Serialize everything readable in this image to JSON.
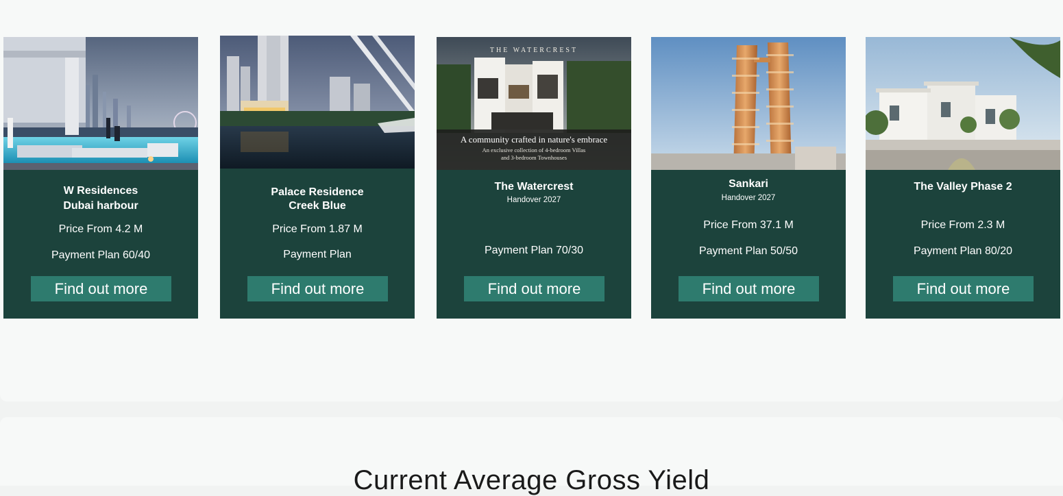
{
  "cards": [
    {
      "title_line1": "W Residences",
      "title_line2": "Dubai harbour",
      "price": "Price From 4.2 M",
      "payment": "Payment Plan 60/40",
      "button": "Find out more"
    },
    {
      "title_line1": "Palace Residence",
      "title_line2": "Creek Blue",
      "price": "Price From 1.87 M",
      "payment": "Payment Plan",
      "button": "Find out more"
    },
    {
      "title_line1": "The Watercrest",
      "subtitle": "Handover 2027",
      "price": "",
      "payment": "Payment Plan 70/30",
      "button": "Find out more",
      "image_text": {
        "brand": "THE WATERCREST",
        "tagline": "A community crafted in nature's embrace",
        "line1": "An exclusive collection of 4-bedroom Villas",
        "line2": "and 3-bedroom Townhouses"
      }
    },
    {
      "title_line1": "Sankari",
      "subtitle": "Handover 2027",
      "price": "Price From 37.1 M",
      "payment": "Payment Plan 50/50",
      "button": "Find out more"
    },
    {
      "title_line1": "The Valley Phase 2",
      "price": "Price From 2.3 M",
      "payment": "Payment Plan 80/20",
      "button": "Find out more"
    }
  ],
  "section": {
    "title": "Current Average Gross Yield"
  },
  "colors": {
    "card_bg": "#1c433c",
    "button_bg": "#2e7b6e",
    "page_bg": "#f7f9f8"
  }
}
